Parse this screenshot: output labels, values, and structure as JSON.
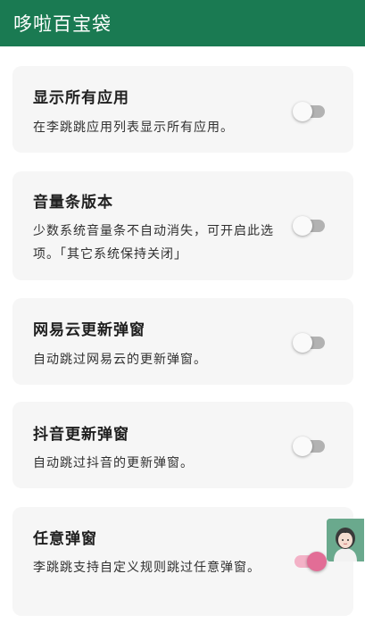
{
  "app_title": "哆啦百宝袋",
  "settings": [
    {
      "title": "显示所有应用",
      "desc": "在李跳跳应用列表显示所有应用。",
      "enabled": false
    },
    {
      "title": "音量条版本",
      "desc": "少数系统音量条不自动消失，可开启此选项。「其它系统保持关闭」",
      "enabled": false
    },
    {
      "title": "网易云更新弹窗",
      "desc": "自动跳过网易云的更新弹窗。",
      "enabled": false
    },
    {
      "title": "抖音更新弹窗",
      "desc": "自动跳过抖音的更新弹窗。",
      "enabled": false
    },
    {
      "title": "任意弹窗",
      "desc": "李跳跳支持自定义规则跳过任意弹窗。",
      "enabled": true
    }
  ],
  "colors": {
    "appbar": "#1a7a52",
    "switch_on": "#e26d96",
    "switch_off": "#b2b2b2"
  },
  "floating_widget": {
    "icon": "avatar-icon"
  }
}
